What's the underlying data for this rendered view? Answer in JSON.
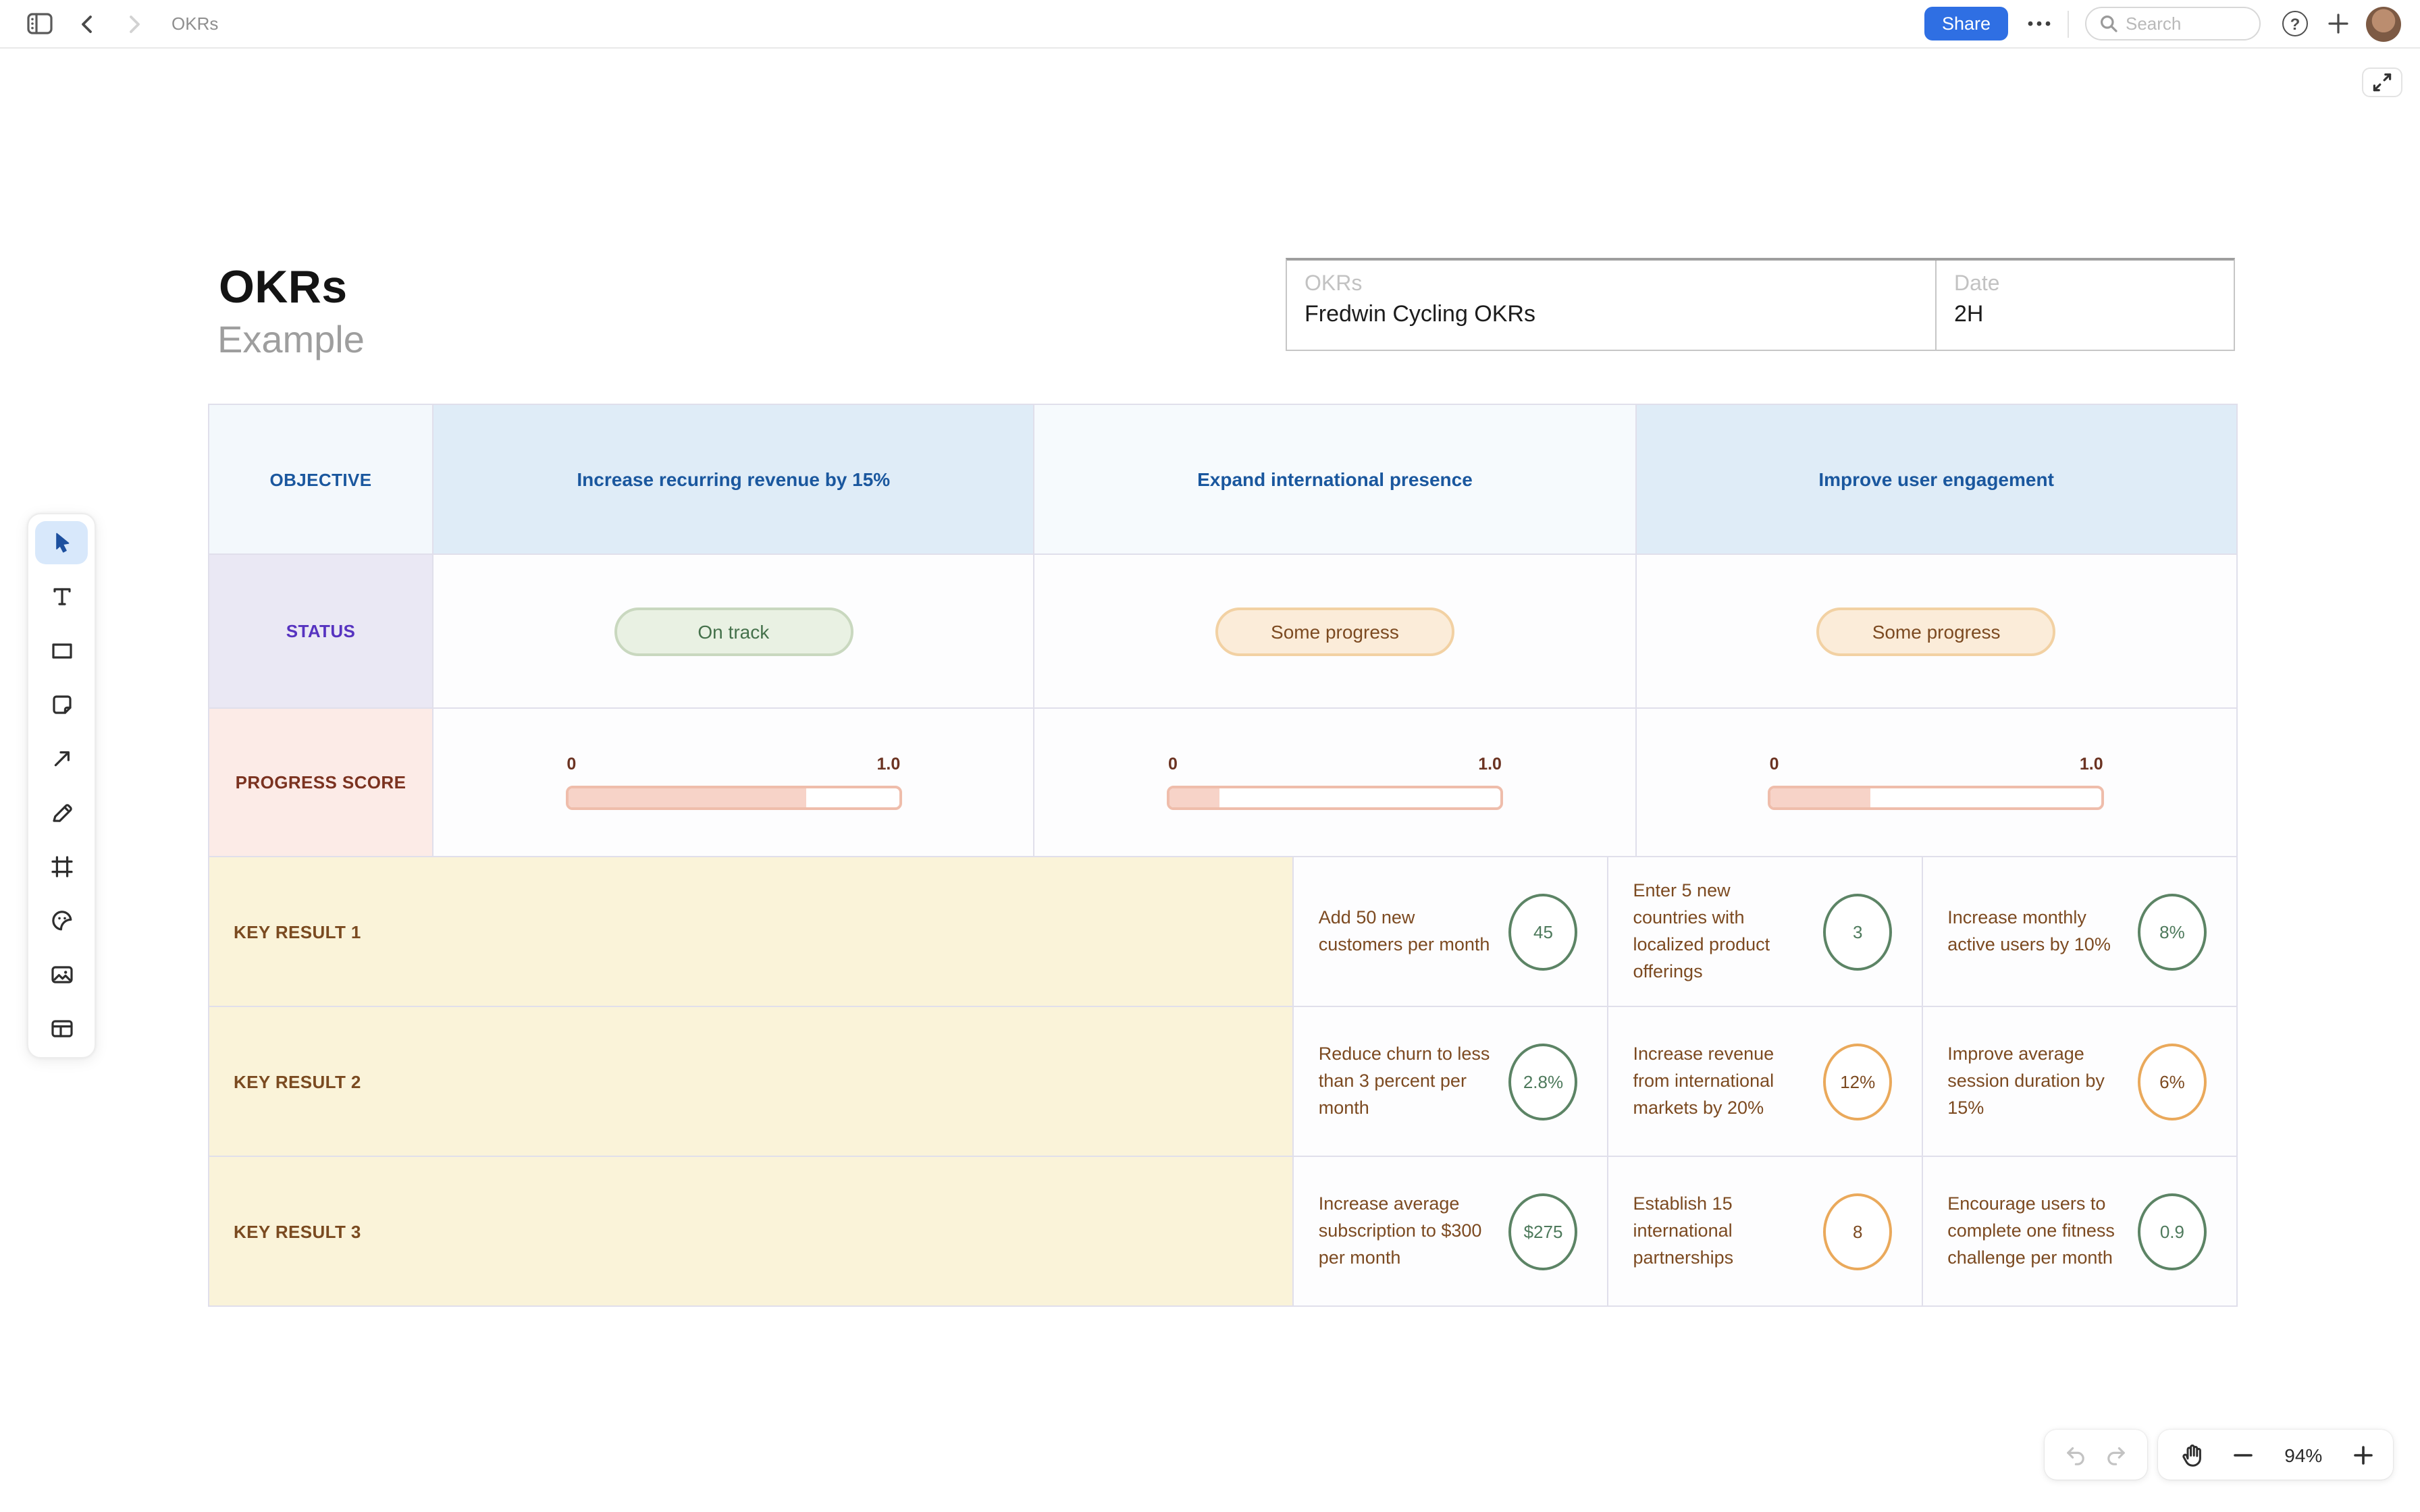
{
  "topbar": {
    "title": "OKRs",
    "share": "Share",
    "search_placeholder": "Search",
    "help_glyph": "?"
  },
  "canvas": {
    "title": "OKRs",
    "subtitle": "Example",
    "meta": {
      "field1_label": "OKRs",
      "field1_value": "Fredwin Cycling OKRs",
      "field2_label": "Date",
      "field2_value": "2H"
    }
  },
  "tools": [
    "select",
    "text",
    "shape",
    "sticky-note",
    "arrow",
    "pen",
    "frame",
    "sticker",
    "image",
    "table"
  ],
  "table": {
    "row_labels": {
      "objective": "OBJECTIVE",
      "status": "STATUS",
      "progress": "PROGRESS SCORE",
      "kr1": "KEY RESULT 1",
      "kr2": "KEY RESULT 2",
      "kr3": "KEY RESULT 3"
    },
    "progress_axis": {
      "min": "0",
      "max": "1.0"
    },
    "columns": [
      {
        "objective": "Increase recurring revenue by 15%",
        "status": {
          "label": "On track",
          "kind": "green"
        },
        "progress": 0.72,
        "key_results": [
          {
            "text": "Add 50 new customers per month",
            "value": "45",
            "color": "green"
          },
          {
            "text": "Reduce churn to less than 3 percent per month",
            "value": "2.8%",
            "color": "green"
          },
          {
            "text": "Increase average subscription to $300 per month",
            "value": "$275",
            "color": "green"
          }
        ]
      },
      {
        "objective": "Expand international presence",
        "status": {
          "label": "Some progress",
          "kind": "amber"
        },
        "progress": 0.15,
        "key_results": [
          {
            "text": "Enter 5 new countries with localized product offerings",
            "value": "3",
            "color": "green"
          },
          {
            "text": "Increase revenue from international markets by 20%",
            "value": "12%",
            "color": "orange"
          },
          {
            "text": "Establish 15 international partnerships",
            "value": "8",
            "color": "orange"
          }
        ]
      },
      {
        "objective": "Improve user engagement",
        "status": {
          "label": "Some progress",
          "kind": "amber"
        },
        "progress": 0.3,
        "key_results": [
          {
            "text": "Increase monthly active users by 10%",
            "value": "8%",
            "color": "green"
          },
          {
            "text": "Improve average session duration by 15%",
            "value": "6%",
            "color": "orange"
          },
          {
            "text": "Encourage users to complete one fitness challenge per month",
            "value": "0.9",
            "color": "green"
          }
        ]
      }
    ]
  },
  "controls": {
    "zoom_level": "94%"
  },
  "colors": {
    "accent_blue": "#2f6fe3",
    "header_text_blue": "#1a579e",
    "status_purple": "#5733c0",
    "progress_rust": "#7b3220",
    "kr_brown": "#7c4a21",
    "circle_green": "#5c8465",
    "circle_orange": "#eaa95b"
  }
}
